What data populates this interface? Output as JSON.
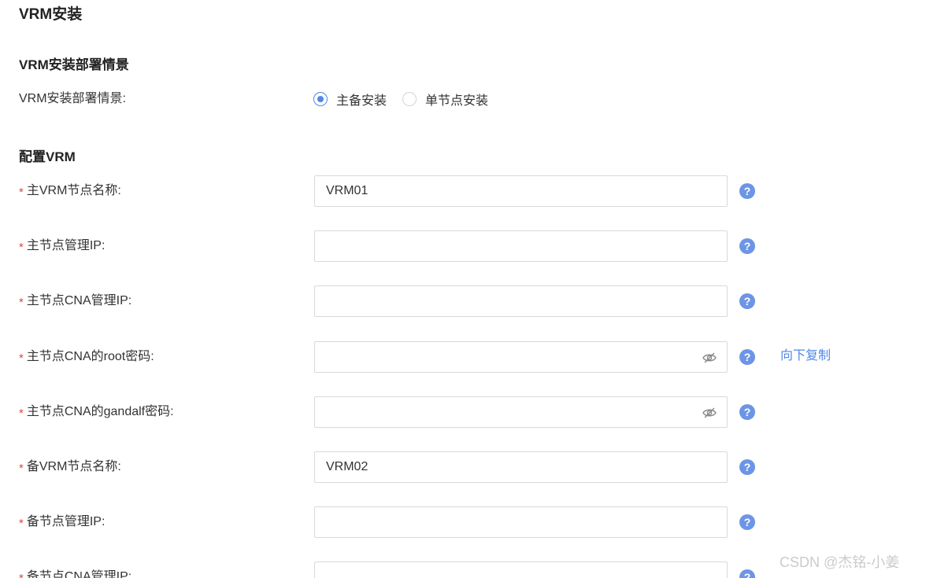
{
  "page": {
    "title": "VRM安装"
  },
  "deploy_section": {
    "title": "VRM安装部署情景",
    "field_label": "VRM安装部署情景:",
    "options": [
      {
        "label": "主备安装",
        "selected": true
      },
      {
        "label": "单节点安装",
        "selected": false
      }
    ]
  },
  "config_section": {
    "title": "配置VRM",
    "required_mark": "*",
    "fields": [
      {
        "label": "主VRM节点名称:",
        "value": "VRM01",
        "type": "text"
      },
      {
        "label": "主节点管理IP:",
        "value": "",
        "type": "text"
      },
      {
        "label": "主节点CNA管理IP:",
        "value": "",
        "type": "text"
      },
      {
        "label": "主节点CNA的root密码:",
        "value": "",
        "type": "password"
      },
      {
        "label": "主节点CNA的gandalf密码:",
        "value": "",
        "type": "password"
      },
      {
        "label": "备VRM节点名称:",
        "value": "VRM02",
        "type": "text"
      },
      {
        "label": "备节点管理IP:",
        "value": "",
        "type": "text"
      },
      {
        "label": "备节点CNA管理IP:",
        "value": "",
        "type": "text"
      }
    ],
    "copy_down_label": "向下复制",
    "help_glyph": "?"
  },
  "watermark": "CSDN @杰铭-小姜",
  "colors": {
    "accent": "#4f88e8",
    "help_icon": "#6d95e6",
    "required": "#e2463e",
    "border": "#d9d9d9"
  },
  "icons": {
    "help": "question-mark-circle-icon",
    "password_toggle": "eye-slash-icon"
  }
}
